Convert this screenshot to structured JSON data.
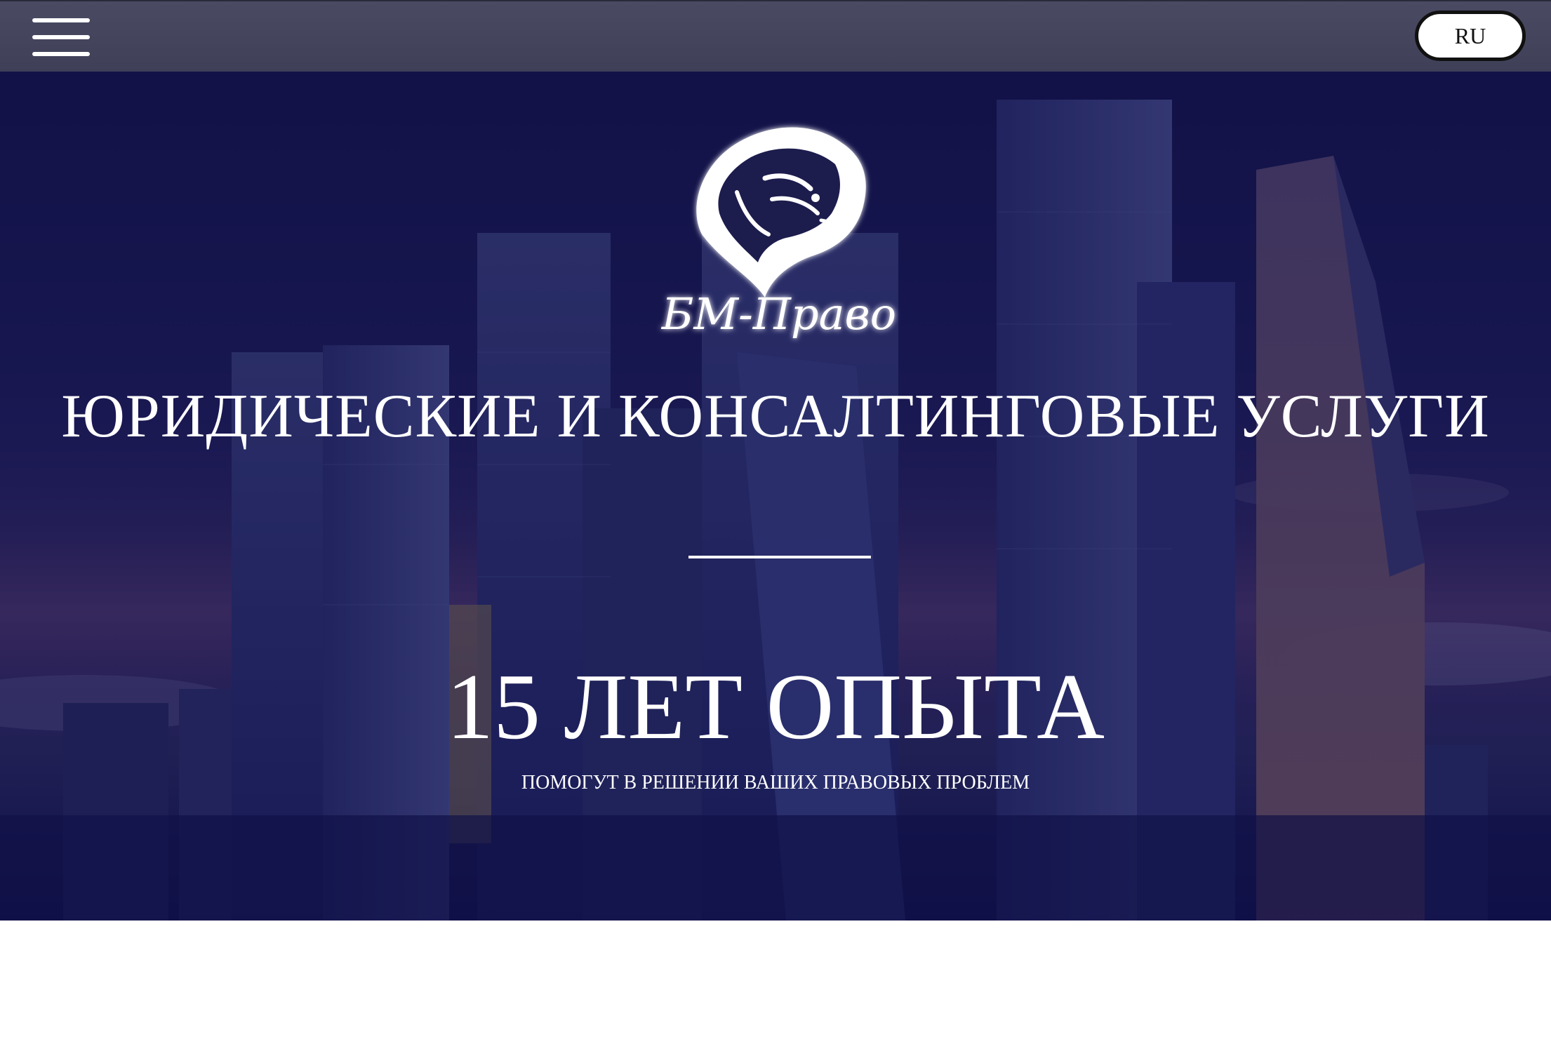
{
  "header": {
    "menu_label": "",
    "language": "RU"
  },
  "hero": {
    "logo_text": "БМ-Право",
    "headline": "ЮРИДИЧЕСКИЕ И КОНСАЛТИНГОВЫЕ УСЛУГИ",
    "big_text": "15 ЛЕТ ОПЫТА",
    "subtext": "ПОМОГУТ В РЕШЕНИИ ВАШИХ ПРАВОВЫХ ПРОБЛЕМ"
  },
  "colors": {
    "topbar": "#44445c",
    "hero_overlay": "#14144a",
    "text": "#ffffff"
  },
  "icons": {
    "menu": "hamburger-icon",
    "logo": "tiger-head-logo"
  }
}
